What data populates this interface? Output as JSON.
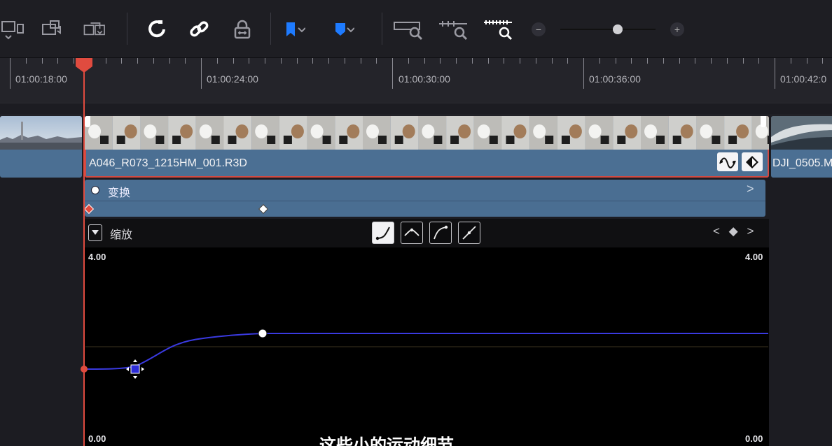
{
  "toolbar": {
    "icons": [
      "overwrite-clip-icon",
      "replace-clip-icon",
      "place-on-top-icon",
      "snapping-icon",
      "linked-selection-icon",
      "position-lock-icon",
      "flag-icon",
      "marker-icon",
      "full-extent-zoom-icon",
      "detail-zoom-icon",
      "custom-zoom-icon"
    ],
    "flag_color": "#1e7bff",
    "marker_color": "#1e7bff",
    "zoom_minus": "−",
    "zoom_plus": "+",
    "zoom_level": 0.6
  },
  "ruler": {
    "labels": [
      "01:00:18:00",
      "01:00:24:00",
      "01:00:30:00",
      "01:00:36:00",
      "01:00:42:0"
    ]
  },
  "clips": {
    "left_clip_name": "",
    "main_clip_name": "A046_R073_1215HM_001.R3D",
    "right_clip_name": "DJI_0505.M"
  },
  "fx_lane": {
    "label": "变换",
    "expand_icon": ">"
  },
  "curve_editor": {
    "title": "缩放",
    "nav": "< ◆ >",
    "y_max_left": "4.00",
    "y_min_left": "0.00",
    "y_max_right": "4.00",
    "y_min_right": "0.00",
    "curve_color": "#3a3ae0"
  },
  "subtitle": "这些小的运动细节",
  "colors": {
    "playhead": "#e04b3f",
    "clip_blue": "#4b6f93",
    "selection": "#d24a42"
  }
}
